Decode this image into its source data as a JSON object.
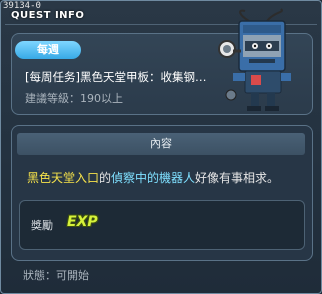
{
  "header": {
    "quest_id": "39134-0",
    "title": "QUEST INFO"
  },
  "quest": {
    "badge": "每週",
    "name": "[每周任务]黑色天堂甲板：收集钢…",
    "level": "建議等級：190以上"
  },
  "npc": {
    "icon": "robot-npc-icon",
    "colors": {
      "body": "#3a6ea8",
      "visor": "#2c3e50",
      "goggle": "#e8e8e8"
    }
  },
  "content": {
    "header": "內容",
    "text_parts": [
      {
        "text": "黑色天堂入口",
        "color": "yellow"
      },
      {
        "text": "的",
        "color": "white"
      },
      {
        "text": "偵察中的機器人",
        "color": "cyan"
      },
      {
        "text": "好像有事相求。",
        "color": "white"
      }
    ]
  },
  "reward": {
    "label": "獎勵",
    "exp_text": "EXP"
  },
  "status": {
    "text": "狀態：可開始"
  },
  "colors": {
    "highlight_yellow": "#f6e24a",
    "highlight_cyan": "#7fe0ff",
    "badge_blue": "#37a9e6",
    "exp_green": "#d6f23a"
  }
}
